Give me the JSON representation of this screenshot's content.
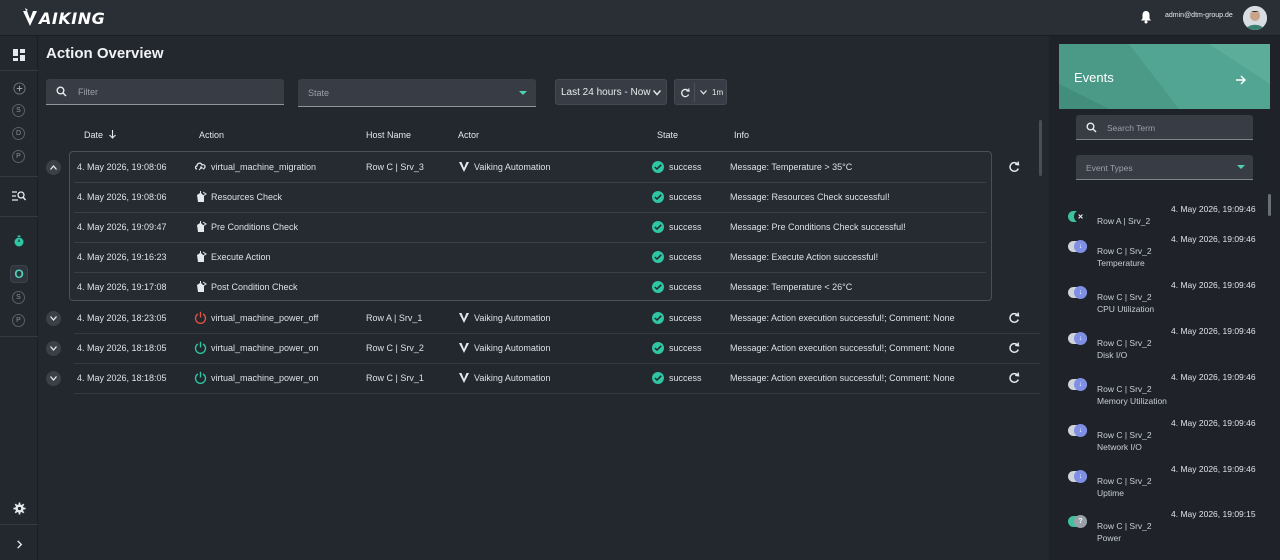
{
  "app": {
    "logo_text": "AIKING"
  },
  "header": {
    "user_email": "admin@dtm-group.de"
  },
  "nav": {
    "letters_top": [
      "S",
      "D",
      "P"
    ],
    "active_letter": "O",
    "letters_bottom": [
      "S",
      "P"
    ]
  },
  "main": {
    "title": "Action Overview",
    "filter_placeholder": "Filter",
    "state_placeholder": "State",
    "time_range": "Last 24 hours - Now",
    "refresh_interval": "1m",
    "columns": [
      "Date",
      "Action",
      "Host Name",
      "Actor",
      "State",
      "Info"
    ],
    "rows": [
      {
        "date": "4. May 2026, 19:08:06",
        "action": "virtual_machine_migration",
        "host": "Row C | Srv_3",
        "actor": "Vaiking Automation",
        "state": "success",
        "info": "Message: Temperature > 35°C"
      },
      {
        "date": "4. May 2026, 19:08:06",
        "action": "Resources Check",
        "host": "",
        "actor": "",
        "state": "success",
        "info": "Message: Resources Check successful!"
      },
      {
        "date": "4. May 2026, 19:09:47",
        "action": "Pre Conditions Check",
        "host": "",
        "actor": "",
        "state": "success",
        "info": "Message: Pre Conditions Check successful!"
      },
      {
        "date": "4. May 2026, 19:16:23",
        "action": "Execute Action",
        "host": "",
        "actor": "",
        "state": "success",
        "info": "Message: Execute Action successful!"
      },
      {
        "date": "4. May 2026, 19:17:08",
        "action": "Post Condition Check",
        "host": "",
        "actor": "",
        "state": "success",
        "info": "Message: Temperature < 26°C"
      },
      {
        "date": "4. May 2026, 18:23:05",
        "action": "virtual_machine_power_off",
        "host": "Row A | Srv_1",
        "actor": "Vaiking Automation",
        "state": "success",
        "info": "Message: Action execution successful!; Comment: None"
      },
      {
        "date": "4. May 2026, 18:18:05",
        "action": "virtual_machine_power_on",
        "host": "Row C | Srv_2",
        "actor": "Vaiking Automation",
        "state": "success",
        "info": "Message: Action execution successful!; Comment: None"
      },
      {
        "date": "4. May 2026, 18:18:05",
        "action": "virtual_machine_power_on",
        "host": "Row C | Srv_1",
        "actor": "Vaiking Automation",
        "state": "success",
        "info": "Message: Action execution successful!; Comment: None"
      }
    ]
  },
  "events": {
    "title": "Events",
    "search_placeholder": "Search Term",
    "types_placeholder": "Event Types",
    "items": [
      {
        "time": "4. May 2026, 19:09:46",
        "host": "Row A | Srv_2",
        "metric": "",
        "kind": "critical"
      },
      {
        "time": "4. May 2026, 19:09:46",
        "host": "Row C | Srv_2",
        "metric": "Temperature",
        "kind": "info"
      },
      {
        "time": "4. May 2026, 19:09:46",
        "host": "Row C | Srv_2",
        "metric": "CPU Utilization",
        "kind": "info"
      },
      {
        "time": "4. May 2026, 19:09:46",
        "host": "Row C | Srv_2",
        "metric": "Disk I/O",
        "kind": "info"
      },
      {
        "time": "4. May 2026, 19:09:46",
        "host": "Row C | Srv_2",
        "metric": "Memory Utilization",
        "kind": "info"
      },
      {
        "time": "4. May 2026, 19:09:46",
        "host": "Row C | Srv_2",
        "metric": "Network I/O",
        "kind": "info"
      },
      {
        "time": "4. May 2026, 19:09:46",
        "host": "Row C | Srv_2",
        "metric": "Uptime",
        "kind": "info"
      },
      {
        "time": "4. May 2026, 19:09:15",
        "host": "Row C | Srv_2",
        "metric": "Power",
        "kind": "unknown"
      }
    ]
  },
  "colors": {
    "accent": "#2fc6a4",
    "events_card": "#4a9a87",
    "background": "#23272e",
    "power_off": "#e0533f",
    "power_on": "#2fc6a4",
    "info_blue": "#7f8fe6"
  }
}
